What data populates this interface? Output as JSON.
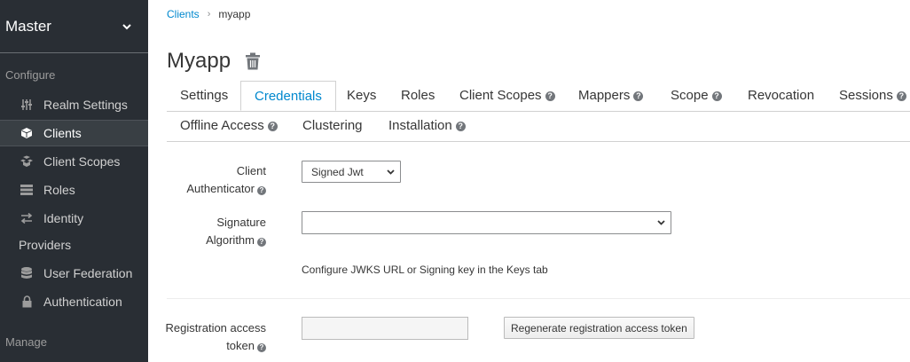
{
  "sidebar": {
    "realm": "Master",
    "configure_label": "Configure",
    "manage_label": "Manage",
    "items": [
      {
        "label": "Realm Settings",
        "icon": "sliders-icon"
      },
      {
        "label": "Clients",
        "icon": "cube-icon"
      },
      {
        "label": "Client Scopes",
        "icon": "cubes-icon"
      },
      {
        "label": "Roles",
        "icon": "list-icon"
      },
      {
        "label": "Identity",
        "icon": "exchange-icon"
      },
      {
        "label": "Providers",
        "icon": ""
      },
      {
        "label": "User Federation",
        "icon": "database-icon"
      },
      {
        "label": "Authentication",
        "icon": "lock-icon"
      }
    ]
  },
  "breadcrumb": {
    "parent": "Clients",
    "current": "myapp"
  },
  "page": {
    "title": "Myapp"
  },
  "tabs": [
    {
      "label": "Settings",
      "help": false
    },
    {
      "label": "Credentials",
      "help": false
    },
    {
      "label": "Keys",
      "help": false
    },
    {
      "label": "Roles",
      "help": false
    },
    {
      "label": "Client Scopes",
      "help": true
    },
    {
      "label": "Mappers",
      "help": true
    },
    {
      "label": "Scope",
      "help": true
    },
    {
      "label": "Revocation",
      "help": false
    },
    {
      "label": "Sessions",
      "help": true
    },
    {
      "label": "Offline Access",
      "help": true
    },
    {
      "label": "Clustering",
      "help": false
    },
    {
      "label": "Installation",
      "help": true
    }
  ],
  "form": {
    "client_authenticator": {
      "label_line1": "Client",
      "label_line2": "Authenticator",
      "value": "Signed Jwt"
    },
    "signature_algorithm": {
      "label_line1": "Signature",
      "label_line2": "Algorithm",
      "value": ""
    },
    "help_text": "Configure JWKS URL or Signing key in the Keys tab",
    "registration_token": {
      "label_line1": "Registration access",
      "label_line2": "token",
      "value": ""
    },
    "regenerate_button": "Regenerate registration access token"
  },
  "colors": {
    "sidebar_bg": "#292e34",
    "accent": "#0088ce"
  }
}
